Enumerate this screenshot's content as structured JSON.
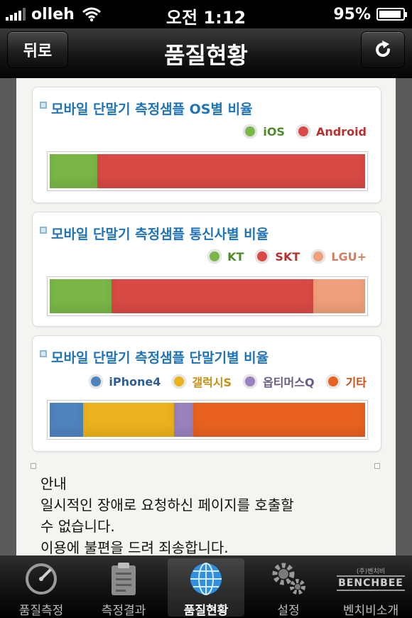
{
  "status_bar": {
    "carrier": "olleh",
    "time": "오전 1:12",
    "battery": "95%",
    "battery_level": 0.95
  },
  "nav": {
    "back_label": "뒤로",
    "title": "품질현황",
    "refresh_icon": "refresh-icon"
  },
  "charts": [
    {
      "title": "모바일 단말기 측정샘플 OS별 비율",
      "legend": [
        {
          "label": "iOS",
          "color": "#7ab648",
          "text_color": "#4f8a2a"
        },
        {
          "label": "Android",
          "color": "#d84a45",
          "text_color": "#b8312e"
        }
      ]
    },
    {
      "title": "모바일 단말기 측정샘플 통신사별 비율",
      "legend": [
        {
          "label": "KT",
          "color": "#7ab648",
          "text_color": "#4f8a2a"
        },
        {
          "label": "SKT",
          "color": "#d84a45",
          "text_color": "#b8312e"
        },
        {
          "label": "LGU+",
          "color": "#f0a07a",
          "text_color": "#d08060"
        }
      ]
    },
    {
      "title": "모바일 단말기 측정샘플 단말기별 비율",
      "legend": [
        {
          "label": "iPhone4",
          "color": "#4f83be",
          "text_color": "#2f5e95"
        },
        {
          "label": "갤럭시S",
          "color": "#ecb21d",
          "text_color": "#c58f12"
        },
        {
          "label": "옵티머스Q",
          "color": "#9a82be",
          "text_color": "#6a5a88"
        },
        {
          "label": "기타",
          "color": "#e8611f",
          "text_color": "#c84e14"
        }
      ]
    }
  ],
  "chart_data": [
    {
      "type": "bar",
      "stacked": true,
      "orientation": "horizontal",
      "title": "모바일 단말기 측정샘플 OS별 비율",
      "categories": [
        "iOS",
        "Android"
      ],
      "values": [
        15,
        85
      ],
      "unit": "%"
    },
    {
      "type": "bar",
      "stacked": true,
      "orientation": "horizontal",
      "title": "모바일 단말기 측정샘플 통신사별 비율",
      "categories": [
        "KT",
        "SKT",
        "LGU+"
      ],
      "values": [
        19.5,
        64,
        16.5
      ],
      "unit": "%"
    },
    {
      "type": "bar",
      "stacked": true,
      "orientation": "horizontal",
      "title": "모바일 단말기 측정샘플 단말기별 비율",
      "categories": [
        "iPhone4",
        "갤럭시S",
        "옵티머스Q",
        "기타"
      ],
      "values": [
        10.5,
        29,
        6,
        54.5
      ],
      "unit": "%"
    }
  ],
  "notice": {
    "lines": [
      "안내",
      "일시적인 장애로 요청하신 페이지를 호출할",
      "수 없습니다.",
      "이용에 불편을 드려 죄송합니다."
    ]
  },
  "tabs": [
    {
      "label": "품질측정",
      "icon": "speedometer-icon",
      "active": false
    },
    {
      "label": "측정결과",
      "icon": "clipboard-icon",
      "active": false
    },
    {
      "label": "품질현황",
      "icon": "globe-icon",
      "active": true
    },
    {
      "label": "설정",
      "icon": "gear-icon",
      "active": false
    },
    {
      "label": "벤치비소개",
      "icon": "benchbee-logo-icon",
      "logo_text": "BENCHBEE",
      "logo_small": "(주)벤치비",
      "active": false
    }
  ]
}
